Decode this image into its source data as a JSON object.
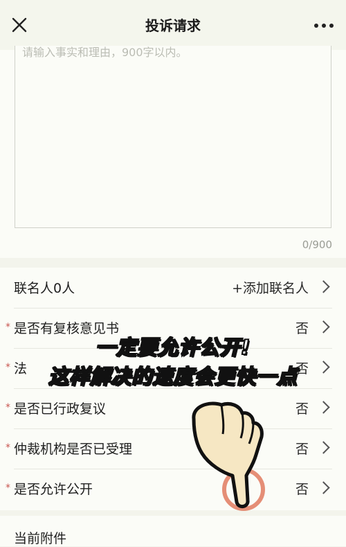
{
  "header": {
    "title": "投诉请求",
    "close_icon": "close-icon",
    "more_icon": "more-icon"
  },
  "textarea": {
    "placeholder": "请输入事实和理由，900字以内。",
    "char_count": "0/900"
  },
  "form": {
    "rows": [
      {
        "label": "联名人0人",
        "value": "+添加联名人",
        "required": false
      },
      {
        "label": "是否有复核意见书",
        "value": "否",
        "required": true
      },
      {
        "label": "法",
        "value": "否",
        "required": true
      },
      {
        "label": "是否已行政复议",
        "value": "否",
        "required": true
      },
      {
        "label": "仲裁机构是否已受理",
        "value": "否",
        "required": true
      },
      {
        "label": "是否允许公开",
        "value": "否",
        "required": true
      }
    ],
    "required_mark": "*"
  },
  "attachments": {
    "label": "当前附件"
  },
  "overlay": {
    "line1": "一定要允许公开!",
    "line2": "这样解决的速度会更快一点"
  },
  "colors": {
    "background": "#f3f4ec",
    "card": "#fbfcf7",
    "required": "#c8554f",
    "highlight_circle": "#e07a5f",
    "hand_fill": "#f6e7c3"
  }
}
